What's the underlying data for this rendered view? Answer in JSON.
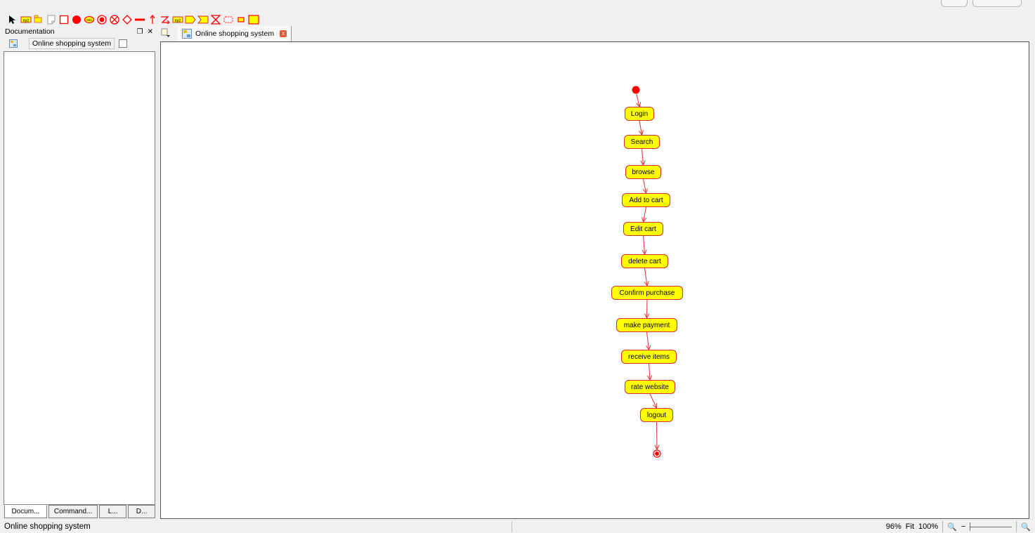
{
  "toolbar": {
    "tools": [
      {
        "icon": "pointer-arrow-icon"
      },
      {
        "icon": "label-xyz-icon"
      },
      {
        "icon": "package-icon"
      },
      {
        "icon": "note-icon"
      },
      {
        "icon": "boundary-rectangle-icon"
      },
      {
        "icon": "initial-node-icon"
      },
      {
        "icon": "action-abc-icon"
      },
      {
        "icon": "activity-final-icon"
      },
      {
        "icon": "flow-final-icon"
      },
      {
        "icon": "decision-diamond-icon"
      },
      {
        "icon": "fork-bar-icon"
      },
      {
        "icon": "control-flow-icon"
      },
      {
        "icon": "object-flow-icon"
      },
      {
        "icon": "object-node-xyz-icon"
      },
      {
        "icon": "send-signal-icon"
      },
      {
        "icon": "accept-event-icon"
      },
      {
        "icon": "accept-time-event-icon"
      },
      {
        "icon": "interruptible-region-icon"
      },
      {
        "icon": "pin-icon"
      },
      {
        "icon": "partition-icon"
      }
    ],
    "colors": {
      "primary": "#ff0000",
      "fill": "#ffff00",
      "outline": "#d03030"
    }
  },
  "documentation_panel": {
    "title": "Documentation",
    "element_name": "Online shopping system",
    "bottom_tabs": [
      "Docum...",
      "Command...",
      "L...",
      "D..."
    ]
  },
  "editor": {
    "tab_label": "Online shopping system"
  },
  "diagram": {
    "actions": [
      "Login",
      "Search",
      "browse",
      "Add to cart",
      "Edit cart",
      "delete cart",
      "Confirm purchase",
      "make payment",
      "receive items",
      "rate website",
      "logout"
    ],
    "colors": {
      "node_fill": "#ffff00",
      "node_border": "#d03030",
      "edge": "#e03030",
      "initial": "#ff0000"
    }
  },
  "statusbar": {
    "text": "Online shopping system",
    "zoom_percent": "96%",
    "fit_label": "Fit",
    "hundred_label": "100%"
  }
}
